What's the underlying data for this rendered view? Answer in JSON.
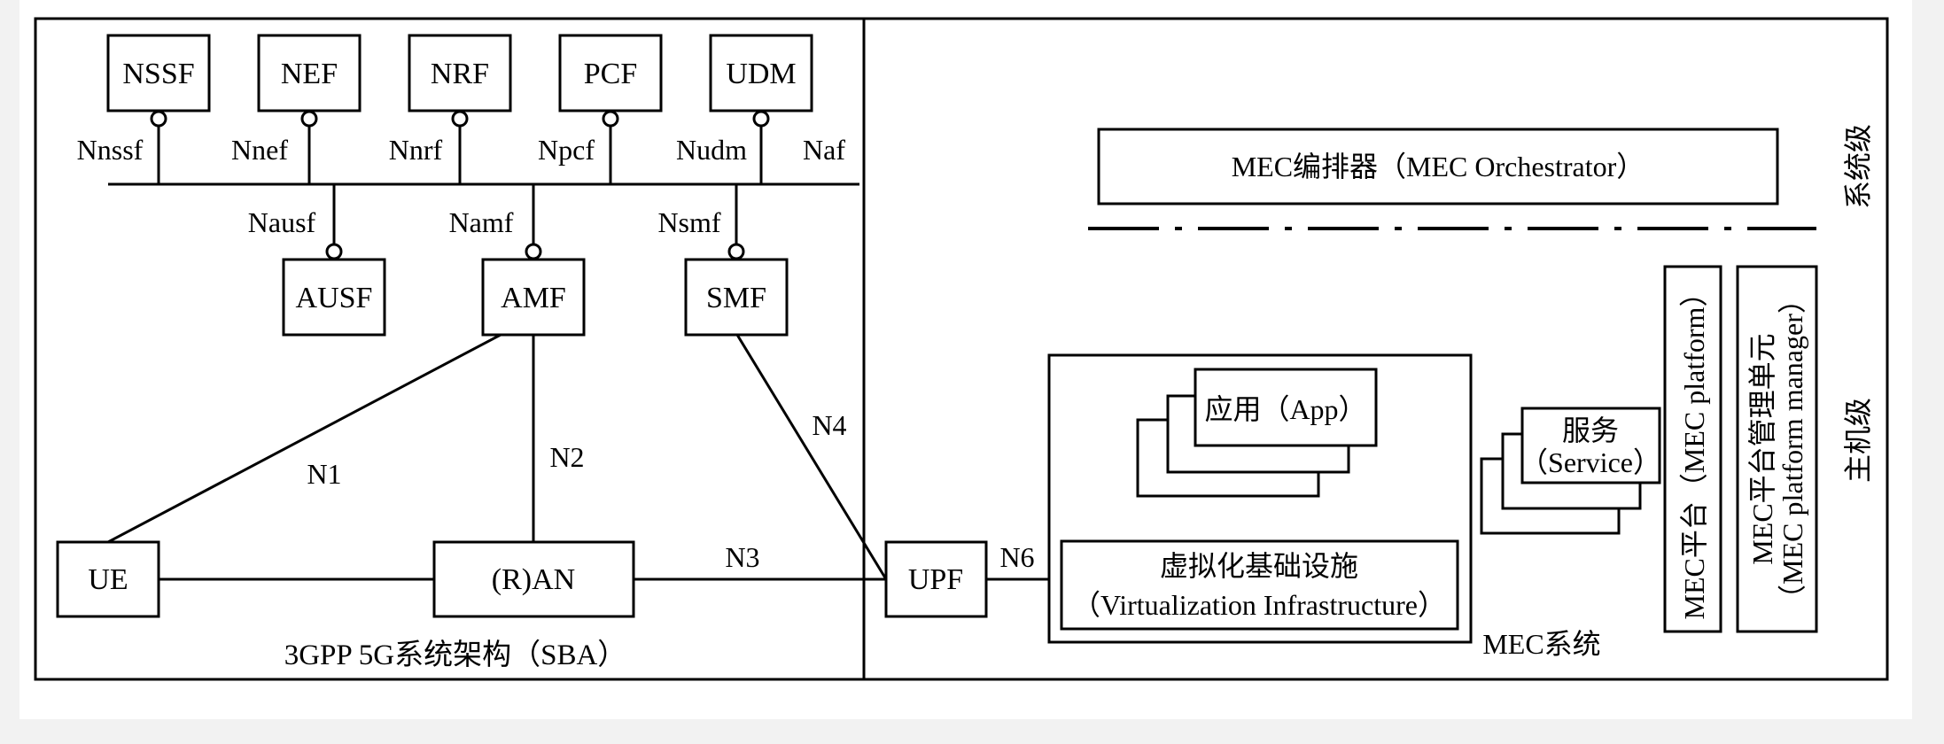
{
  "functions": {
    "nssf": "NSSF",
    "nef": "NEF",
    "nrf": "NRF",
    "pcf": "PCF",
    "udm": "UDM",
    "ausf": "AUSF",
    "amf": "AMF",
    "smf": "SMF",
    "ue": "UE",
    "ran": "(R)AN",
    "upf": "UPF"
  },
  "interfaces": {
    "nnssf": "Nnssf",
    "nnef": "Nnef",
    "nnrf": "Nnrf",
    "npcf": "Npcf",
    "nudm": "Nudm",
    "naf": "Naf",
    "nausf": "Nausf",
    "namf": "Namf",
    "nsmf": "Nsmf",
    "n1": "N1",
    "n2": "N2",
    "n3": "N3",
    "n4": "N4",
    "n6": "N6"
  },
  "captions": {
    "sba": "3GPP 5G系统架构（SBA）",
    "mec_system": "MEC系统",
    "system_level": "系统级",
    "host_level": "主机级"
  },
  "mec": {
    "orchestrator": "MEC编排器（MEC Orchestrator）",
    "app": "应用（App）",
    "service_line1": "服务",
    "service_line2": "（Service）",
    "vi_line1": "虚拟化基础设施",
    "vi_line2": "（Virtualization Infrastructure）",
    "platform": "MEC平台（MEC platform）",
    "pm_line1": "MEC平台管理单元",
    "pm_line2": "（MEC platform manager）"
  }
}
